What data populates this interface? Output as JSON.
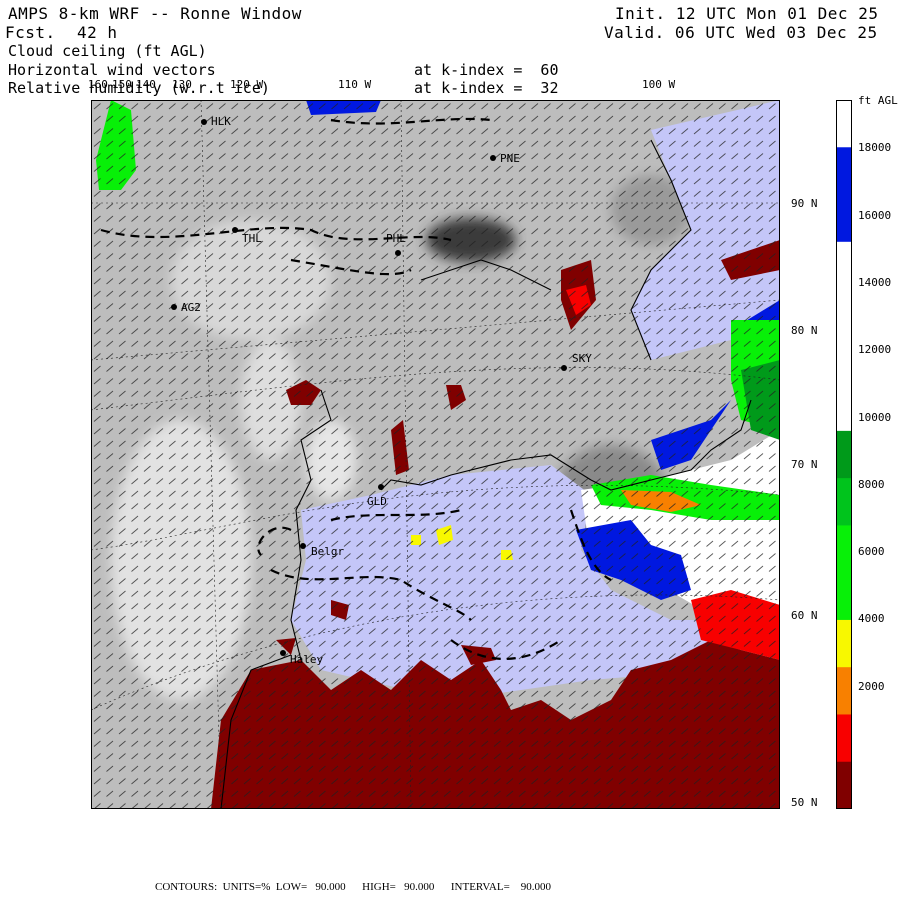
{
  "header": {
    "title": "AMPS 8-km WRF -- Ronne Window",
    "fcst_label": "Fcst.",
    "fcst_value": "42 h",
    "init": "Init. 12 UTC Mon 01 Dec 25",
    "valid": "Valid. 06 UTC Wed 03 Dec 25",
    "field1": "Cloud ceiling (ft AGL)",
    "field2": "Horizontal wind vectors",
    "field3": "Relative humidity (w.r.t ice)",
    "k1": "at k-index =  60",
    "k2": "at k-index =  32"
  },
  "lon_labels": [
    "160",
    "150",
    "140",
    "130",
    "120 W",
    "110 W",
    "100 W"
  ],
  "lat_labels": [
    "90 N",
    "80 N",
    "70 N",
    "60 N",
    "50 N"
  ],
  "colorbar": {
    "unit": "ft AGL",
    "labels": [
      "18000",
      "16000",
      "14000",
      "12000",
      "10000",
      "8000",
      "6000",
      "4000",
      "2000"
    ],
    "colors": [
      "#ffffff",
      "#0018e0",
      "#0018e0",
      "#ffffff",
      "#ffffff",
      "#ffffff",
      "#ffffff",
      "#009a1a",
      "#00c41c",
      "#08f008",
      "#08f008",
      "#f8f800",
      "#f88000",
      "#f80000",
      "#800000"
    ]
  },
  "stations": [
    {
      "name": "HLK"
    },
    {
      "name": "PNE"
    },
    {
      "name": "THL"
    },
    {
      "name": "PHL"
    },
    {
      "name": "AG2"
    },
    {
      "name": "SKY"
    },
    {
      "name": "GLD"
    },
    {
      "name": "Belgr"
    },
    {
      "name": "Haley"
    }
  ],
  "footer": {
    "contours": "CONTOURS:",
    "units": "UNITS=%",
    "low": "LOW=   90.000",
    "high": "HIGH=   90.000",
    "interval": "INTERVAL=    90.000"
  },
  "colors": {
    "land_gray": "#bdbdbd",
    "ice_lavender": "#c4c6f8",
    "ceiling_low": "#800000"
  }
}
